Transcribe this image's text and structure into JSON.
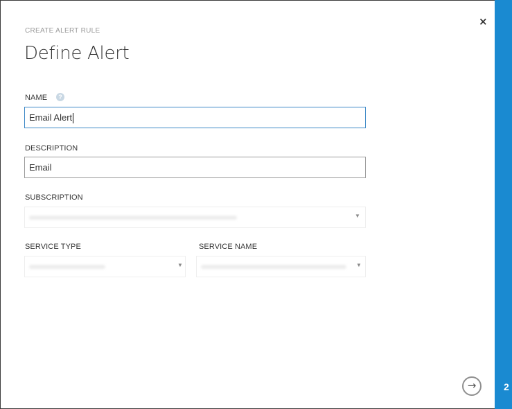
{
  "dialog": {
    "subtitle": "CREATE ALERT RULE",
    "title": "Define Alert",
    "close_glyph": "×",
    "step_number": "2",
    "next_glyph": "→"
  },
  "fields": {
    "name": {
      "label": "NAME",
      "value": "Email Alert",
      "help_glyph": "?"
    },
    "description": {
      "label": "DESCRIPTION",
      "value": "Email"
    },
    "subscription": {
      "label": "SUBSCRIPTION"
    },
    "service_type": {
      "label": "SERVICE TYPE"
    },
    "service_name": {
      "label": "SERVICE NAME"
    }
  },
  "icons": {
    "close": "close-icon",
    "help": "help-icon",
    "next": "arrow-right-icon",
    "dropdown": "chevron-down-icon"
  },
  "colors": {
    "accent": "#1a8ad1",
    "focus_border": "#3c88c6",
    "input_border": "#9a9a9a"
  }
}
